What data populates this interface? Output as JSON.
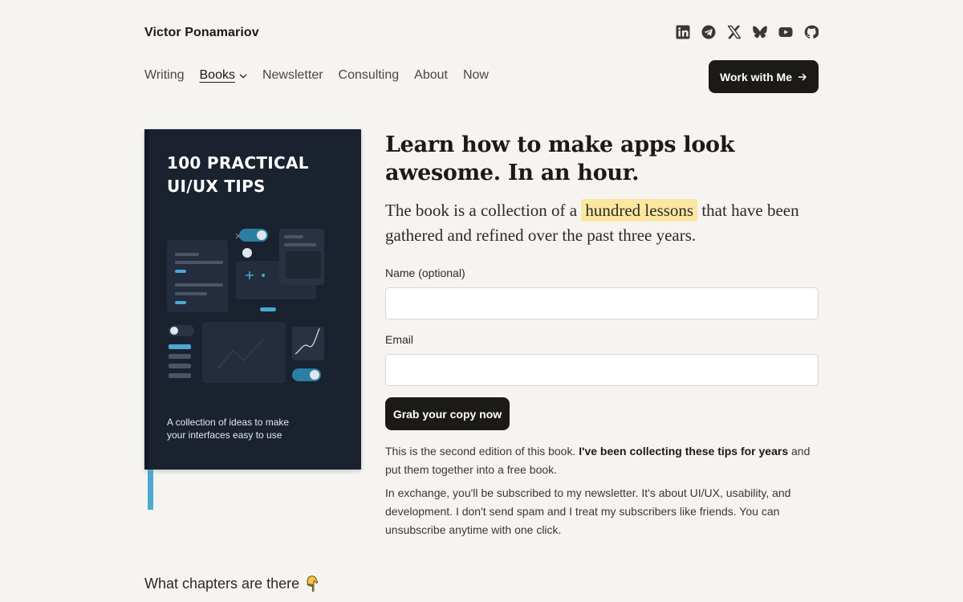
{
  "header": {
    "brand": "Victor Ponamariov",
    "socials": [
      {
        "icon": "linkedin-icon"
      },
      {
        "icon": "telegram-icon"
      },
      {
        "icon": "x-icon"
      },
      {
        "icon": "bluesky-icon"
      },
      {
        "icon": "youtube-icon"
      },
      {
        "icon": "github-icon"
      }
    ],
    "nav": {
      "writing": "Writing",
      "books": "Books",
      "newsletter": "Newsletter",
      "consulting": "Consulting",
      "about": "About",
      "now": "Now"
    },
    "cta_label": "Work with Me",
    "cta_icon": "arrow-right-icon"
  },
  "book": {
    "title_line1": "100 PRACTICAL",
    "title_line2": "UI/UX TIPS",
    "subtitle_line1": "A collection of ideas to make",
    "subtitle_line2": "your interfaces easy to use",
    "cover_color": "#1a2230",
    "accent_color": "#4ba9d1"
  },
  "main": {
    "headline_line1": "Learn how to make apps look",
    "headline_line2": "awesome. In an hour.",
    "lead_before": "The book is a collection of a ",
    "lead_highlight": "hundred lessons",
    "lead_after": " that have been gathered and refined over the past three years.",
    "highlight_color": "#fbe7a0",
    "form": {
      "name_label": "Name (optional)",
      "name_value": "",
      "email_label": "Email",
      "email_value": "",
      "submit_label": "Grab your copy now"
    },
    "note1_before": "This is the second edition of this book. ",
    "note1_bold": "I've been collecting these tips for years",
    "note1_after": " and put them together into a free book.",
    "note2": "In exchange, you'll be subscribed to my newsletter. It's about UI/UX, usability, and development. I don't send spam and I treat my subscribers like friends. You can unsubscribe anytime with one click.",
    "chapters_label": "What chapters are there",
    "chapters_icon": "pointing-down-hand-icon"
  }
}
